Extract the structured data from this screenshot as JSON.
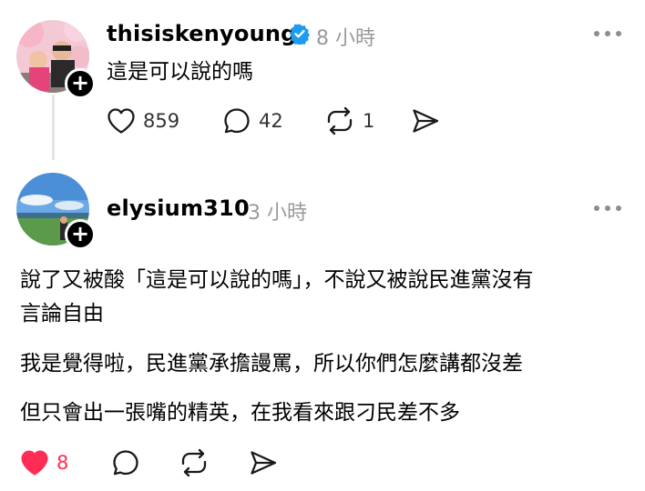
{
  "posts": [
    {
      "username": "thisiskenyoung",
      "verified": true,
      "timestamp": "8 小時",
      "lines": [
        "這是可以說的嗎"
      ],
      "likes": "859",
      "comments": "42",
      "reposts": "1",
      "liked": false
    },
    {
      "username": "elysium310",
      "verified": false,
      "timestamp": "3 小時",
      "lines": [
        "說了又被酸「這是可以說的嗎」，不說又被說民進黨沒有",
        "言論自由",
        "我是覺得啦，民進黨承擔謾罵，所以你們怎麼講都沒差",
        "但只會出一張嘴的精英，在我看來跟刁民差不多"
      ],
      "likes": "8",
      "liked": true
    }
  ],
  "colors": {
    "like": "#ff2d55",
    "verified": "#1d9bf0",
    "muted": "#9a9a9a"
  },
  "icons": [
    "heart-icon",
    "comment-icon",
    "repost-icon",
    "share-icon",
    "more-icon",
    "plus-icon",
    "verified-icon"
  ]
}
